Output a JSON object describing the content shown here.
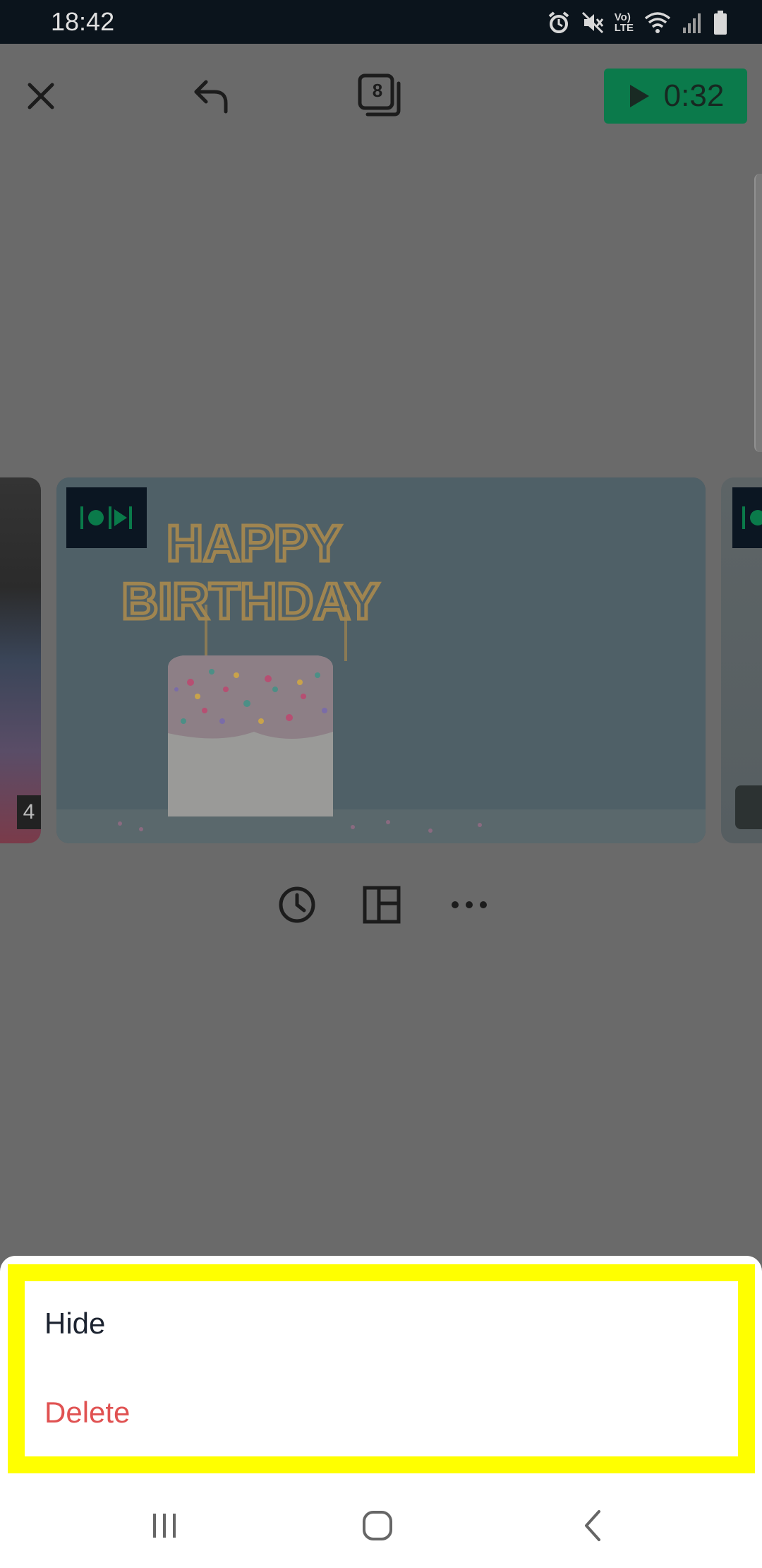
{
  "status_bar": {
    "time": "18:42",
    "icons": [
      "alarm-icon",
      "mute-icon",
      "volte-icon",
      "wifi-icon",
      "signal-icon",
      "battery-icon"
    ],
    "volte_label_top": "Vo)",
    "volte_label_bottom": "LTE"
  },
  "toolbar": {
    "close_icon": "close-icon",
    "undo_icon": "undo-icon",
    "slide_count": "8",
    "play_duration": "0:32",
    "play_button_color": "#0b7a4b"
  },
  "slides": {
    "left_partial_badge": "4",
    "main_cake_text_line1": "HAPPY",
    "main_cake_text_line2": "BIRTHDAY"
  },
  "slide_actions": {
    "icons": [
      "clock-icon",
      "layout-icon",
      "more-icon"
    ]
  },
  "bottom_sheet": {
    "hide_label": "Hide",
    "delete_label": "Delete",
    "delete_color": "#e05252",
    "highlight_color": "#ffff00"
  },
  "navbar": {
    "icons": [
      "recent-apps-icon",
      "home-icon",
      "back-icon"
    ]
  }
}
